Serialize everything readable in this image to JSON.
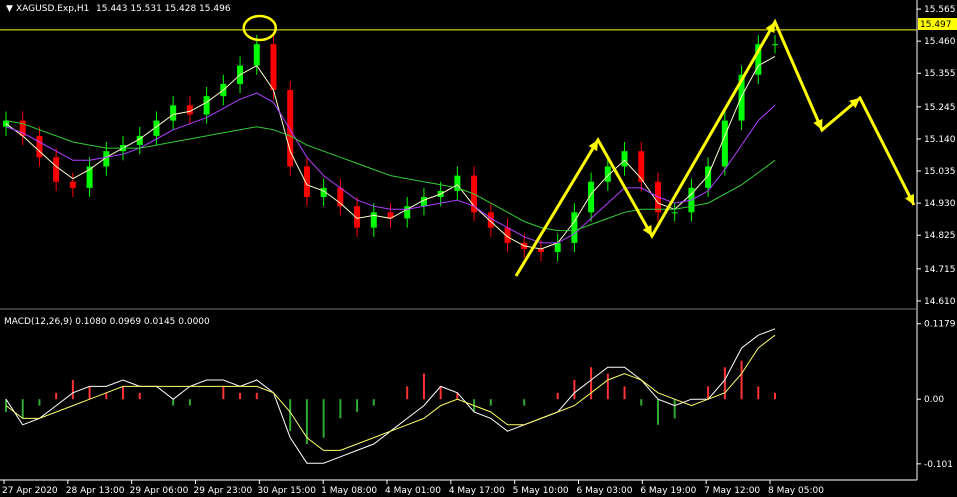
{
  "symbol_label": "XAGUSD.Exp,H1",
  "ohlc_label": "15.443 15.531 15.428 15.496",
  "macd_label": "MACD(12,26,9) 0.1080 0.0969 0.0145 0.0000",
  "current_price_badge": "15.497",
  "colors": {
    "background": "#000000",
    "bull": "#00ff00",
    "bear": "#ff0000",
    "ma_fast": "#ffffcc",
    "ma_mid": "#b040ff",
    "ma_slow": "#33cc33",
    "annotation": "#ffff00",
    "hist": "#ff3333",
    "hist_neg": "#33aa33",
    "signal": "#ffff66",
    "macd_line": "#ffffff"
  },
  "chart_data": [
    {
      "type": "candlestick",
      "symbol": "XAGUSD.Exp",
      "timeframe": "H1",
      "y_ticks": [
        "15.565",
        "15.460",
        "15.355",
        "15.245",
        "15.140",
        "15.035",
        "14.930",
        "14.825",
        "14.715",
        "14.610"
      ],
      "ylim": [
        14.6,
        15.575
      ],
      "current_price": 15.497,
      "x_ticks": [
        "27 Apr 2020",
        "28 Apr 13:00",
        "29 Apr 06:00",
        "29 Apr 23:00",
        "30 Apr 15:00",
        "1 May 08:00",
        "4 May 01:00",
        "4 May 17:00",
        "5 May 10:00",
        "6 May 03:00",
        "6 May 19:00",
        "7 May 12:00",
        "8 May 05:00"
      ],
      "series": [
        {
          "name": "close",
          "values": [
            15.2,
            15.15,
            15.08,
            15.0,
            14.98,
            15.05,
            15.1,
            15.12,
            15.15,
            15.2,
            15.25,
            15.22,
            15.28,
            15.32,
            15.38,
            15.45,
            15.3,
            15.05,
            14.95,
            14.98,
            14.92,
            14.85,
            14.9,
            14.88,
            14.92,
            14.95,
            14.97,
            15.02,
            14.9,
            14.85,
            14.8,
            14.78,
            14.77,
            14.8,
            14.9,
            15.0,
            15.05,
            15.1,
            15.0,
            14.9,
            14.9,
            14.98,
            15.05,
            15.2,
            15.35,
            15.45,
            15.45
          ]
        },
        {
          "name": "ma_fast",
          "values": [
            15.19,
            15.15,
            15.1,
            15.05,
            15.01,
            15.04,
            15.08,
            15.11,
            15.14,
            15.18,
            15.22,
            15.23,
            15.26,
            15.3,
            15.35,
            15.38,
            15.3,
            15.1,
            14.99,
            14.97,
            14.93,
            14.88,
            14.89,
            14.88,
            14.91,
            14.94,
            14.96,
            14.99,
            14.92,
            14.87,
            14.82,
            14.79,
            14.78,
            14.8,
            14.87,
            14.96,
            15.02,
            15.07,
            15.01,
            14.93,
            14.91,
            14.96,
            15.02,
            15.15,
            15.28,
            15.38,
            15.41
          ]
        },
        {
          "name": "ma_mid",
          "values": [
            15.18,
            15.16,
            15.13,
            15.1,
            15.07,
            15.07,
            15.08,
            15.09,
            15.11,
            15.14,
            15.17,
            15.19,
            15.21,
            15.24,
            15.27,
            15.29,
            15.26,
            15.17,
            15.08,
            15.02,
            14.98,
            14.94,
            14.92,
            14.91,
            14.91,
            14.92,
            14.93,
            14.94,
            14.92,
            14.88,
            14.85,
            14.82,
            14.8,
            14.8,
            14.83,
            14.88,
            14.93,
            14.98,
            14.98,
            14.95,
            14.93,
            14.94,
            14.97,
            15.04,
            15.12,
            15.2,
            15.25
          ]
        },
        {
          "name": "ma_slow",
          "values": [
            15.2,
            15.19,
            15.17,
            15.15,
            15.13,
            15.12,
            15.11,
            15.11,
            15.11,
            15.12,
            15.13,
            15.14,
            15.15,
            15.16,
            15.17,
            15.18,
            15.17,
            15.15,
            15.12,
            15.1,
            15.08,
            15.06,
            15.04,
            15.02,
            15.01,
            15.0,
            14.99,
            14.98,
            14.96,
            14.93,
            14.9,
            14.87,
            14.85,
            14.84,
            14.84,
            14.86,
            14.88,
            14.9,
            14.91,
            14.91,
            14.91,
            14.92,
            14.93,
            14.96,
            14.99,
            15.03,
            15.07
          ]
        }
      ],
      "annotations": [
        "price-ceiling-line",
        "high-marker-circle",
        "arrows"
      ]
    },
    {
      "type": "bar",
      "name": "MACD(12,26,9)",
      "y_ticks": [
        "0.1179",
        "0.00",
        "-0.101"
      ],
      "ylim": [
        -0.12,
        0.13
      ],
      "series": [
        {
          "name": "histogram",
          "values": [
            -0.02,
            -0.03,
            -0.01,
            0.01,
            0.03,
            0.02,
            0.01,
            0.02,
            0.01,
            0.0,
            -0.01,
            -0.01,
            0.0,
            0.02,
            0.01,
            0.01,
            0.0,
            -0.05,
            -0.07,
            -0.06,
            -0.03,
            -0.02,
            -0.01,
            0.0,
            0.02,
            0.04,
            0.02,
            0.01,
            -0.02,
            -0.01,
            0.0,
            -0.01,
            0.0,
            0.01,
            0.03,
            0.05,
            0.04,
            0.02,
            -0.01,
            -0.04,
            -0.03,
            0.0,
            0.02,
            0.05,
            0.06,
            0.02,
            0.01
          ]
        },
        {
          "name": "macd",
          "values": [
            0.0,
            -0.04,
            -0.03,
            -0.01,
            0.01,
            0.02,
            0.02,
            0.03,
            0.02,
            0.02,
            0.0,
            0.02,
            0.03,
            0.03,
            0.02,
            0.03,
            0.01,
            -0.06,
            -0.1,
            -0.1,
            -0.09,
            -0.08,
            -0.07,
            -0.05,
            -0.03,
            -0.01,
            0.02,
            0.01,
            -0.02,
            -0.03,
            -0.05,
            -0.04,
            -0.03,
            -0.02,
            0.01,
            0.03,
            0.05,
            0.05,
            0.03,
            0.0,
            -0.01,
            0.0,
            0.0,
            0.03,
            0.08,
            0.1,
            0.11
          ]
        },
        {
          "name": "signal",
          "values": [
            -0.01,
            -0.03,
            -0.03,
            -0.02,
            -0.01,
            0.0,
            0.01,
            0.02,
            0.02,
            0.02,
            0.02,
            0.02,
            0.02,
            0.02,
            0.02,
            0.02,
            0.01,
            -0.02,
            -0.06,
            -0.08,
            -0.08,
            -0.07,
            -0.06,
            -0.05,
            -0.04,
            -0.03,
            -0.01,
            0.0,
            -0.01,
            -0.02,
            -0.04,
            -0.04,
            -0.03,
            -0.02,
            -0.01,
            0.01,
            0.03,
            0.04,
            0.03,
            0.01,
            0.0,
            -0.01,
            0.0,
            0.01,
            0.04,
            0.08,
            0.1
          ]
        }
      ]
    }
  ]
}
